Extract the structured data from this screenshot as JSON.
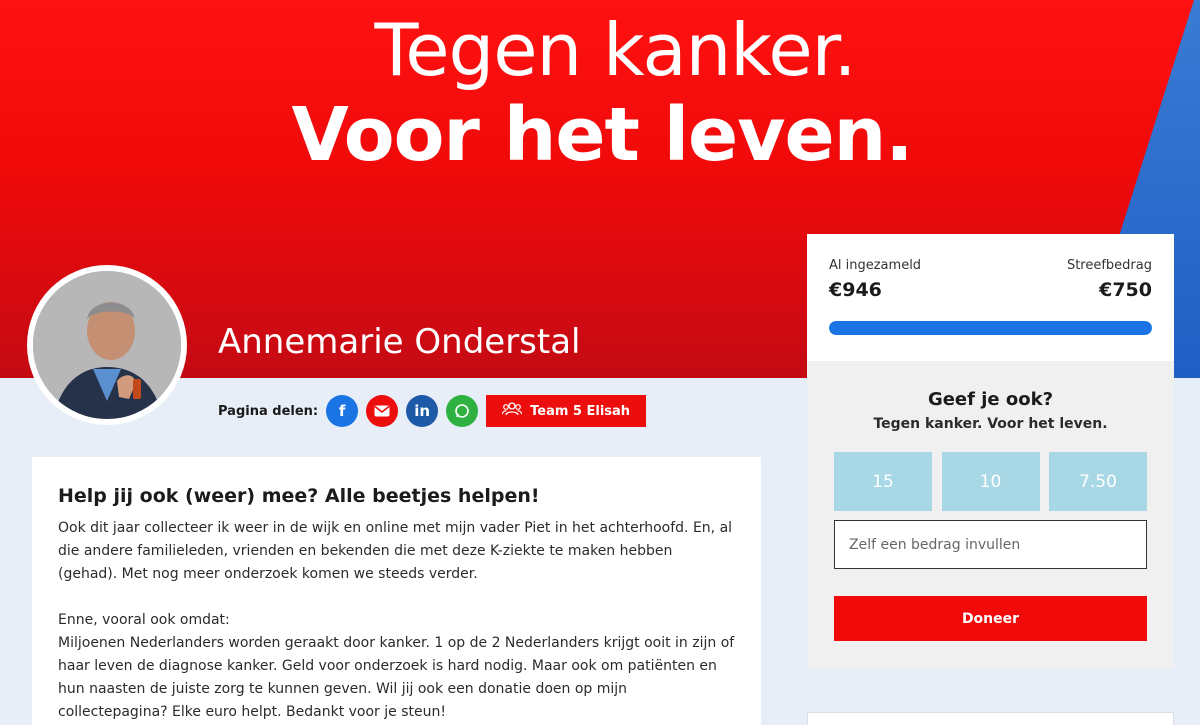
{
  "hero": {
    "line1": "Tegen kanker.",
    "line2": "Voor het leven."
  },
  "profile": {
    "name": "Annemarie Onderstal"
  },
  "share": {
    "label": "Pagina delen:",
    "icons": [
      "facebook-icon",
      "mail-icon",
      "linkedin-icon",
      "whatsapp-icon"
    ],
    "team_label": "Team 5 Elisah"
  },
  "story": {
    "title": "Help jij ook (weer) mee? Alle beetjes helpen!",
    "p1": "Ook dit jaar collecteer ik weer in de wijk en online met mijn vader Piet in het achterhoofd. En, al die andere familieleden, vrienden en bekenden die met deze K-ziekte te maken hebben (gehad). Met nog meer onderzoek komen we steeds verder.",
    "p2": "Enne, vooral ook omdat:",
    "p3": "Miljoenen Nederlanders worden geraakt door kanker. 1 op de 2 Nederlanders krijgt ooit in zijn of haar leven de diagnose kanker. Geld voor onderzoek is hard nodig. Maar ook om patiënten en hun naasten de juiste zorg te kunnen geven. Wil jij ook een donatie doen op mijn collectepagina? Elke euro helpt. Bedankt voor je steun!"
  },
  "donation": {
    "raised_label": "Al ingezameld",
    "raised_value": "€946",
    "target_label": "Streefbedrag",
    "target_value": "€750",
    "progress": 1.0,
    "give_title": "Geef je ook?",
    "give_subtitle": "Tegen kanker. Voor het leven.",
    "amounts": [
      "15",
      "10",
      "7.50"
    ],
    "custom_placeholder": "Zelf een bedrag invullen",
    "donate_label": "Doneer"
  },
  "colors": {
    "brand_red": "#f00a0a",
    "brand_blue": "#1b74e4",
    "amount_tile": "#a8d7e6"
  }
}
